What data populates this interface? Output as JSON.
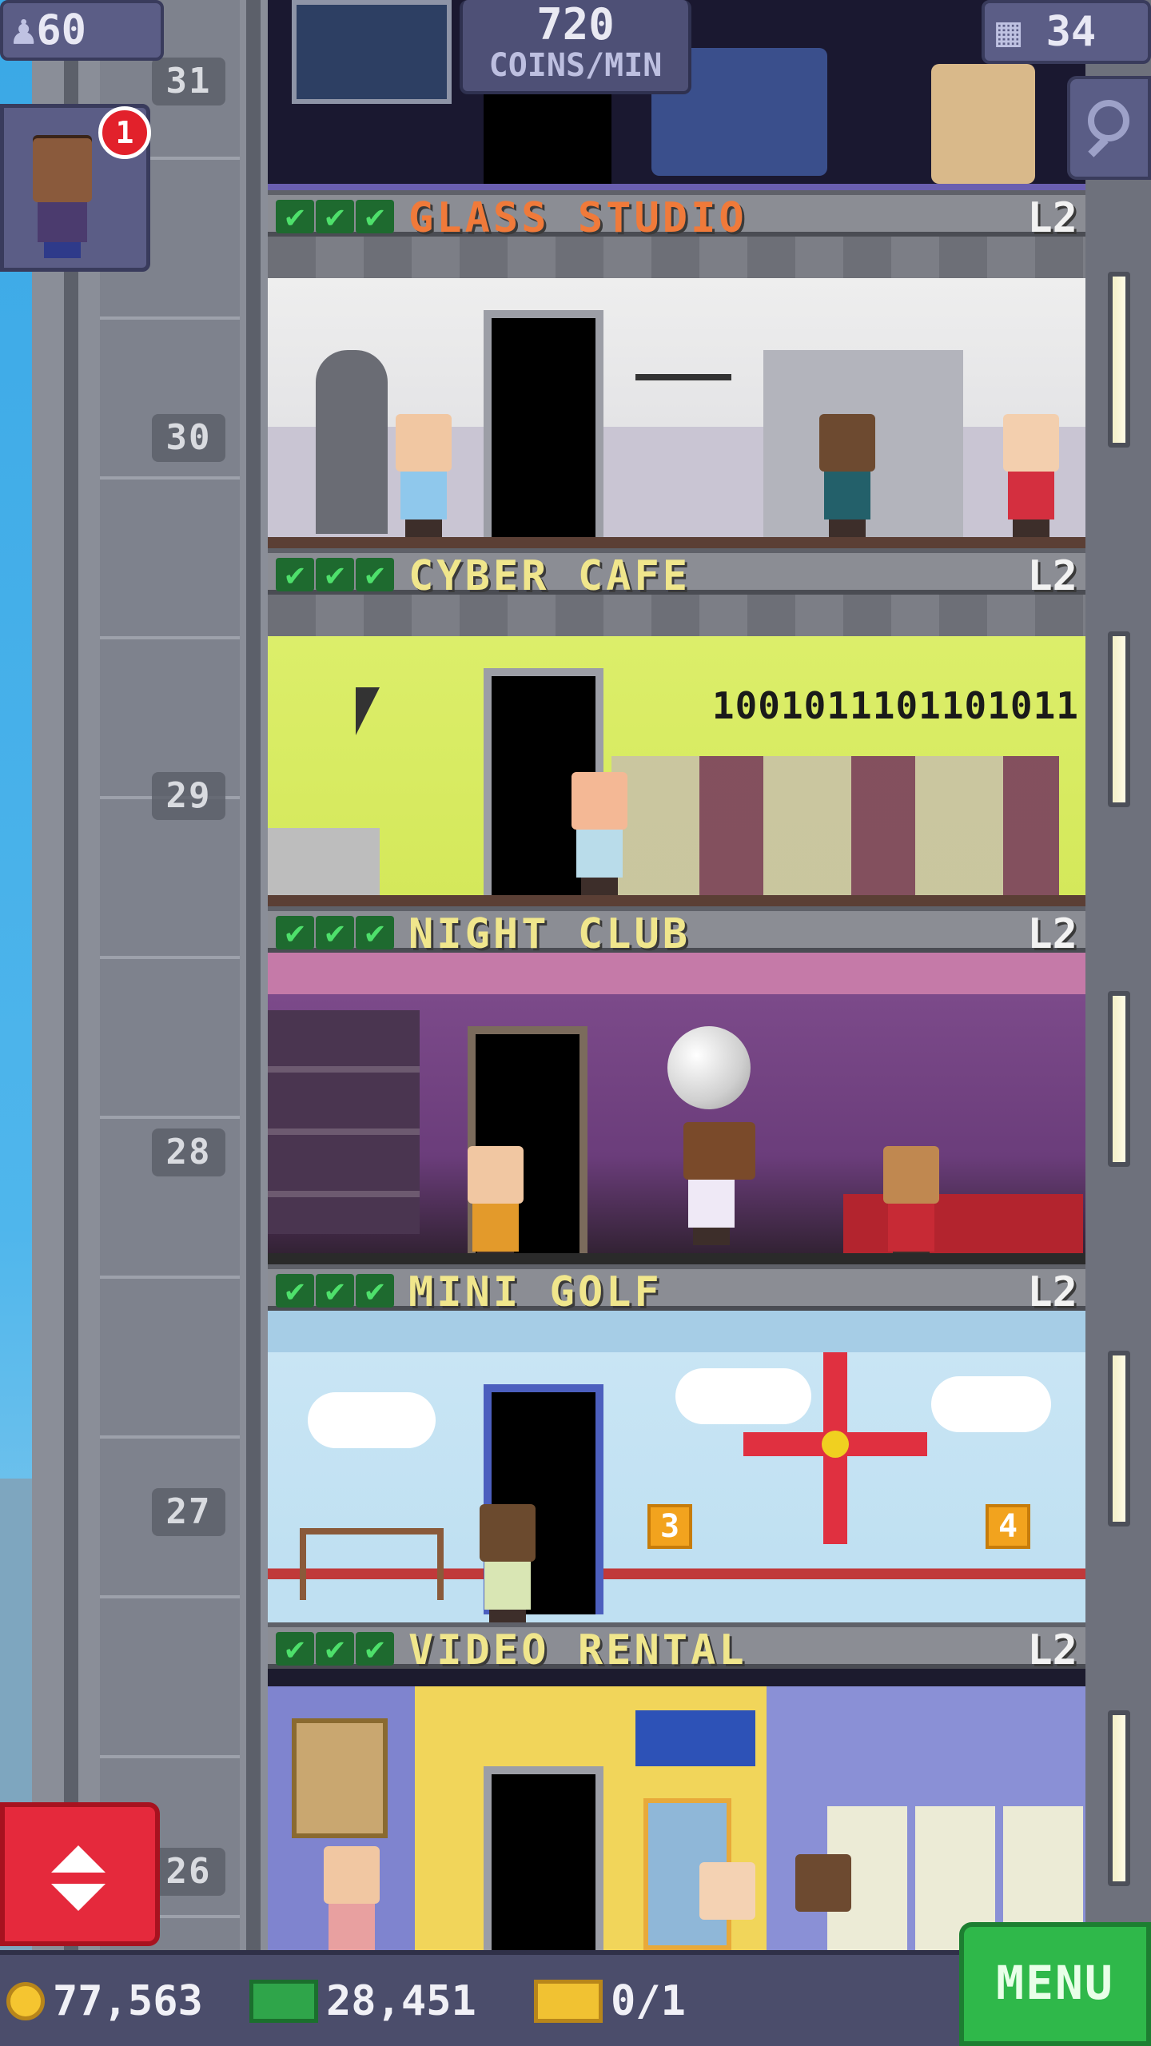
{
  "hud": {
    "population": "60",
    "population_icon": "person-icon",
    "coins_per_min_value": "720",
    "coins_per_min_unit": "COINS/MIN",
    "floor_count": "34",
    "floor_count_icon": "building-icon"
  },
  "visitor_notification": {
    "badge_count": "1"
  },
  "elevator": {
    "floor_labels": [
      "31",
      "30",
      "29",
      "28",
      "27",
      "26"
    ]
  },
  "floors": [
    {
      "name": "GLASS STUDIO",
      "level": "L2",
      "stock_checks": 3,
      "name_color": "#f07a3a"
    },
    {
      "name": "CYBER CAFE",
      "level": "L2",
      "stock_checks": 3,
      "name_color": "#f0e68c",
      "wall_text": "1001011101101011"
    },
    {
      "name": "NIGHT CLUB",
      "level": "L2",
      "stock_checks": 3,
      "name_color": "#f0e68c"
    },
    {
      "name": "MINI GOLF",
      "level": "L2",
      "stock_checks": 3,
      "name_color": "#f0e68c",
      "hole_numbers": [
        "3",
        "4"
      ]
    },
    {
      "name": "VIDEO RENTAL",
      "level": "L2",
      "stock_checks": 3,
      "name_color": "#f0e68c"
    }
  ],
  "bottom_bar": {
    "coins": "77,563",
    "bux": "28,451",
    "tickets": "0/1",
    "menu_label": "MENU"
  },
  "colors": {
    "menu_green": "#2fb84a",
    "elevator_red": "#e5293c",
    "hud_purple": "#5b5d86",
    "check_green": "#4ee06b"
  }
}
